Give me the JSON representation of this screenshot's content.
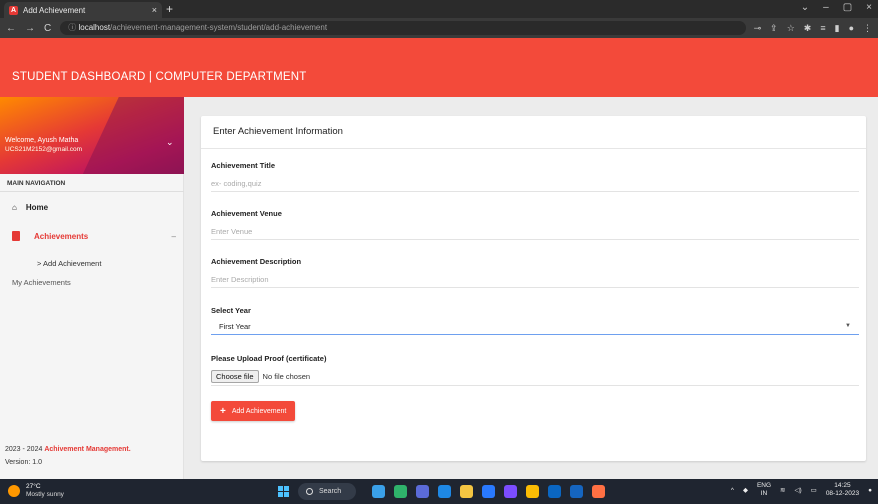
{
  "browser": {
    "tab_title": "Add Achievement",
    "tab_close": "×",
    "new_tab": "+",
    "url_host": "localhost",
    "url_path": "/achievement-management-system/student/add-achievement",
    "window_controls": [
      "⌄",
      "–",
      "▢",
      "×"
    ]
  },
  "header": {
    "title": "STUDENT DASHBOARD | COMPUTER DEPARTMENT"
  },
  "sidebar": {
    "welcome": "Welcome, Ayush Matha",
    "email": "UCS21M2152@gmail.com",
    "nav_heading": "MAIN NAVIGATION",
    "home_label": "Home",
    "achievements_label": "Achievements",
    "achievements_toggle": "–",
    "sub_add": "> Add Achievement",
    "sub_my": "My Achievements",
    "footer_year": "2023 - 2024",
    "footer_org": "Achivement Management.",
    "version": "Version: 1.0"
  },
  "form": {
    "card_title": "Enter Achievement Information",
    "title_label": "Achievement Title",
    "title_placeholder": "ex- coding,quiz",
    "venue_label": "Achievement Venue",
    "venue_placeholder": "Enter Venue",
    "desc_label": "Achievement Description",
    "desc_placeholder": "Enter Description",
    "year_label": "Select Year",
    "year_value": "First Year",
    "proof_label": "Please Upload Proof (certificate)",
    "file_button": "Choose file",
    "file_status": "No file chosen",
    "submit_label": "Add Achievement"
  },
  "taskbar": {
    "temp": "27°C",
    "weather": "Mostly sunny",
    "search": "Search",
    "lang_top": "ENG",
    "lang_bottom": "IN",
    "time": "14:25",
    "date": "08-12-2023"
  },
  "colors": {
    "accent": "#f34a3a",
    "active_nav": "#e53935",
    "select_underline": "#6ea0ef"
  }
}
